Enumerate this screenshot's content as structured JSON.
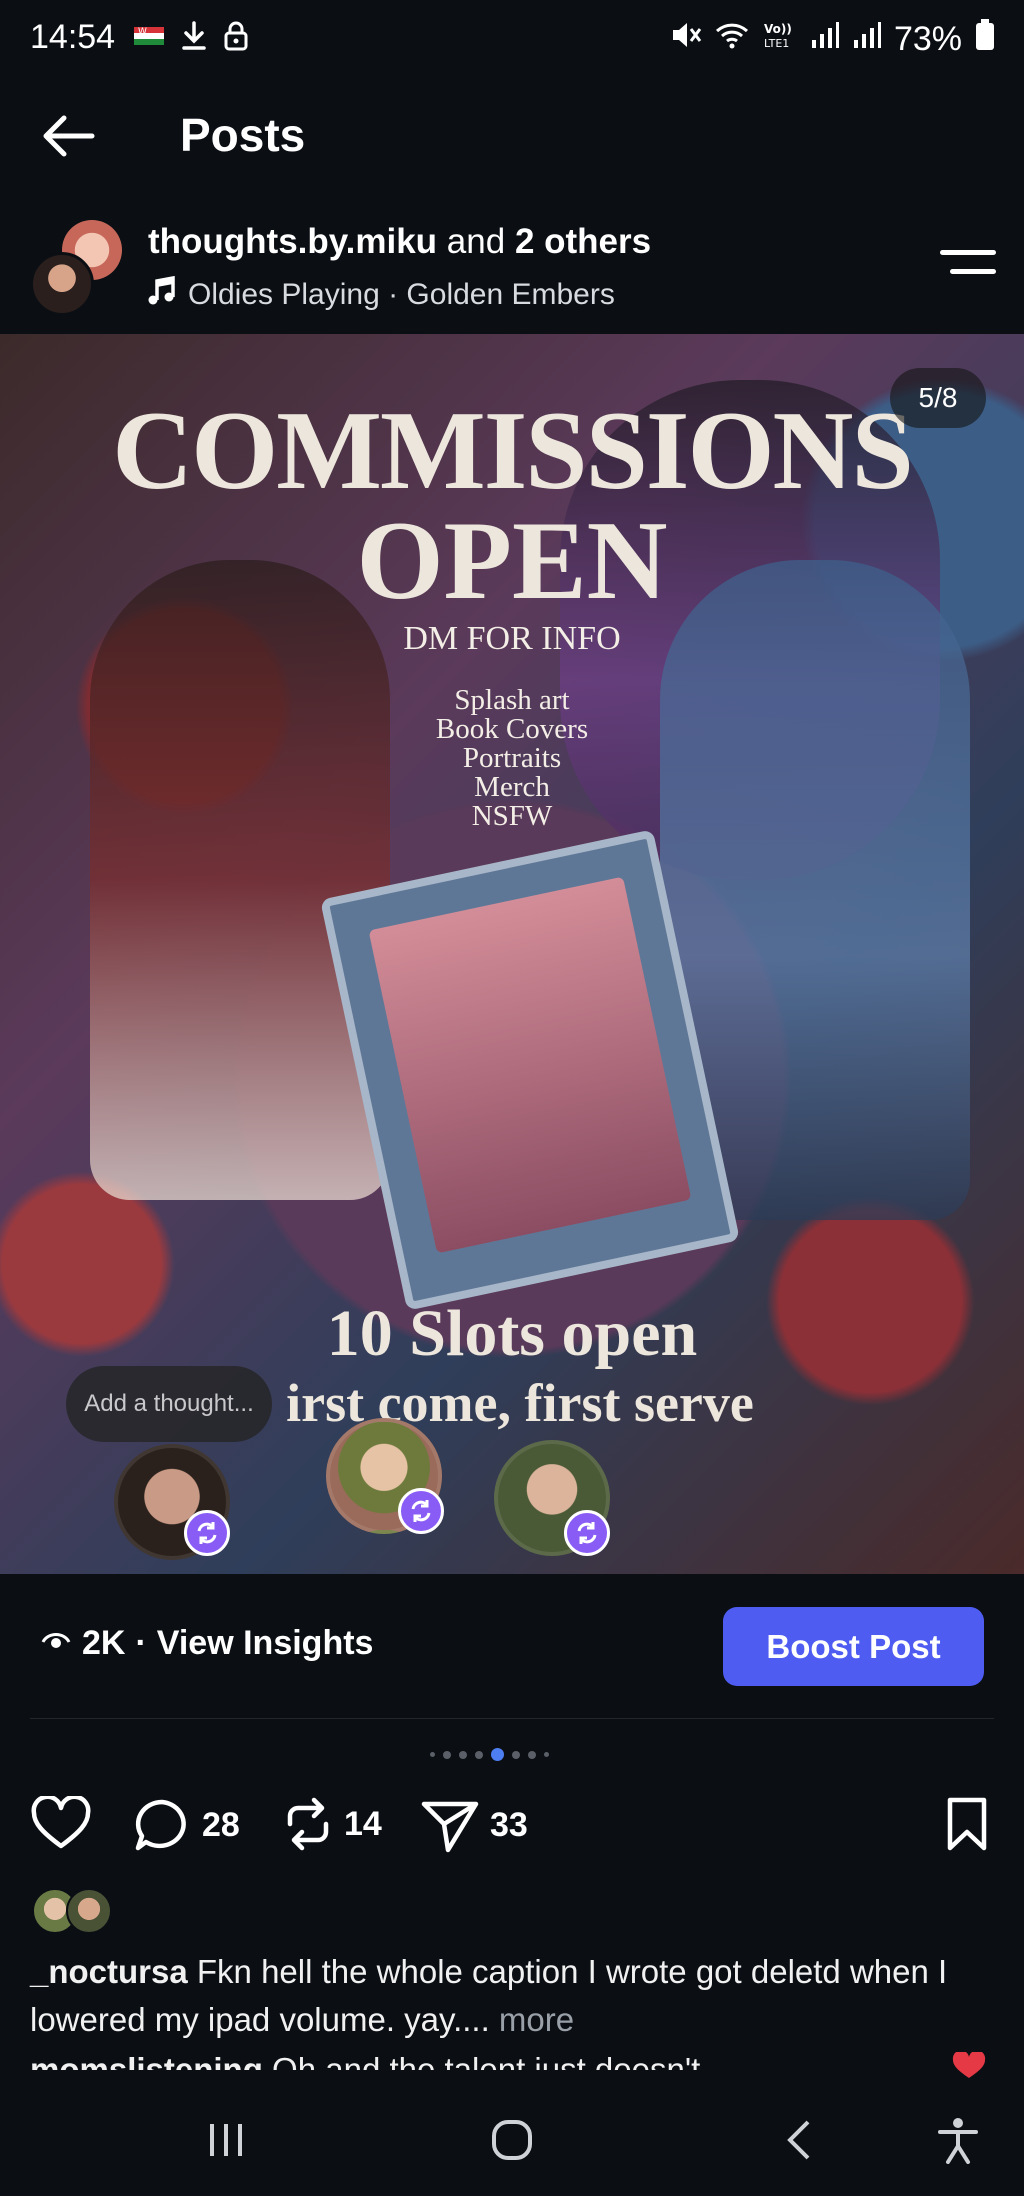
{
  "status_bar": {
    "time": "14:54",
    "battery": "73%"
  },
  "app_bar": {
    "title": "Posts"
  },
  "post": {
    "author": "thoughts.by.miku",
    "author_connector": "and",
    "others": "2 others",
    "music": "Oldies Playing · Golden Embers",
    "slide_counter": "5/8",
    "image_text": {
      "headline_1": "COMMISSIONS",
      "headline_2": "OPEN",
      "subheading": "DM FOR INFO",
      "services": [
        "Splash art",
        "Book Covers",
        "Portraits",
        "Merch",
        "NSFW"
      ],
      "slots": "10 Slots open",
      "first_come": "irst come, first serve"
    },
    "thought_prompt": "Add a thought..."
  },
  "insights": {
    "views": "2K",
    "label": "View Insights",
    "boost_label": "Boost Post"
  },
  "carousel": {
    "total": 8,
    "active_index": 4
  },
  "actions": {
    "comments": "28",
    "reposts": "14",
    "shares": "33"
  },
  "caption": {
    "username": "_noctursa",
    "text": "Fkn hell the whole caption I wrote got deletd when I lowered my ipad volume. yay....",
    "more": "more"
  },
  "second_comment": {
    "username": "momslistening",
    "text": "Oh and the talent just doesn't"
  },
  "colors": {
    "background": "#0b0f14",
    "boost": "#4e5cf2",
    "repost_badge": "#8a5cf6",
    "active_dot": "#4e7ff2",
    "heart": "#e53945"
  }
}
